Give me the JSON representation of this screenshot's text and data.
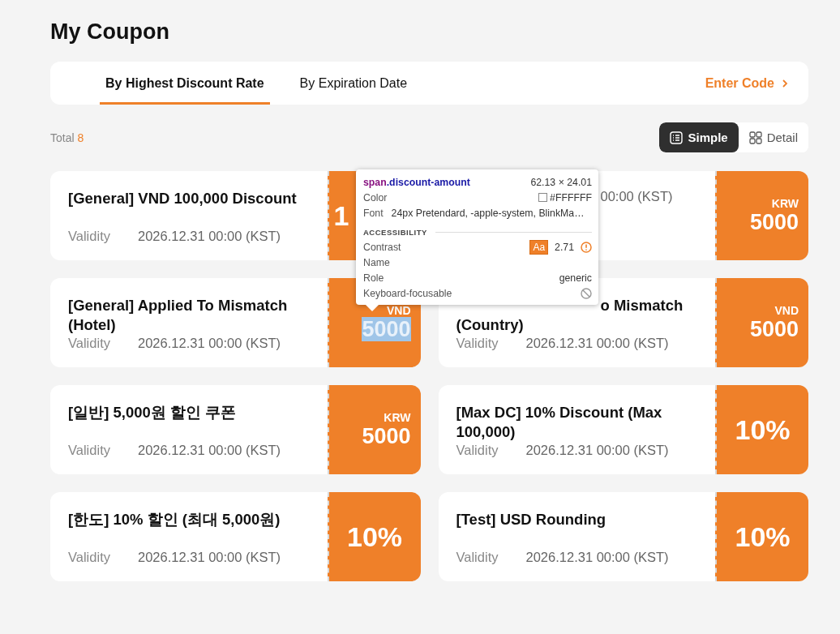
{
  "page_title": "My Coupon",
  "tabs": [
    {
      "label": "By Highest Discount Rate",
      "selected": true
    },
    {
      "label": "By Expiration Date",
      "selected": false
    }
  ],
  "enter_code": "Enter Code",
  "total": {
    "label": "Total",
    "count": "8"
  },
  "view_toggle": [
    {
      "label": "Simple",
      "selected": true,
      "kind": "list"
    },
    {
      "label": "Detail",
      "selected": false,
      "kind": "grid"
    }
  ],
  "coupons": [
    {
      "title": "[General] VND 100,000 Discount",
      "validity_label": "Validity",
      "validity": "2026.12.31 00:00 (KST)",
      "kind": "percent",
      "amount": "1",
      "text_covered": false,
      "stub_covered": true,
      "selected": false
    },
    {
      "validity": "00:00 (KST)",
      "kind": "fixed",
      "currency": "KRW",
      "amount": "5000",
      "text_covered": true,
      "stub_covered": false,
      "selected": false
    },
    {
      "title": "[General] Applied To Mismatch (Hotel)",
      "validity_label": "Validity",
      "validity": "2026.12.31 00:00 (KST)",
      "kind": "fixed",
      "currency": "VND",
      "amount": "5000",
      "text_covered": false,
      "stub_covered": false,
      "selected": true
    },
    {
      "title": "o Mismatch (Country)",
      "validity_label": "Validity",
      "validity": "2026.12.31 00:00 (KST)",
      "kind": "fixed",
      "currency": "VND",
      "amount": "5000",
      "text_covered": true,
      "stub_covered": false,
      "selected": false
    },
    {
      "title": "[일반] 5,000원 할인 쿠폰",
      "validity_label": "Validity",
      "validity": "2026.12.31 00:00 (KST)",
      "kind": "fixed",
      "currency": "KRW",
      "amount": "5000",
      "text_covered": false,
      "stub_covered": false,
      "selected": false
    },
    {
      "title": "[Max DC] 10% Discount (Max 100,000)",
      "validity_label": "Validity",
      "validity": "2026.12.31 00:00 (KST)",
      "kind": "percent",
      "amount": "10%",
      "text_covered": false,
      "stub_covered": false,
      "selected": false
    },
    {
      "title": "[한도] 10% 할인 (최대 5,000원)",
      "validity_label": "Validity",
      "validity": "2026.12.31 00:00 (KST)",
      "kind": "percent",
      "amount": "10%",
      "text_covered": false,
      "stub_covered": false,
      "selected": false
    },
    {
      "title": "[Test] USD Rounding",
      "validity_label": "Validity",
      "validity": "2026.12.31 00:00 (KST)",
      "kind": "percent",
      "amount": "10%",
      "text_covered": false,
      "stub_covered": false,
      "selected": false
    }
  ],
  "inspector": {
    "tag": "span",
    "class_name": ".discount-amount",
    "size": "62.13 × 24.01",
    "rows": [
      {
        "label": "Color",
        "value": "#FFFFFF",
        "kind": "color"
      },
      {
        "label": "Font",
        "value": "24px Pretendard, -apple-system, BlinkMa…",
        "kind": "text"
      }
    ],
    "section": "ACCESSIBILITY",
    "a11y": [
      {
        "label": "Contrast",
        "badge": "Aa",
        "value": "2.71",
        "kind": "contrast"
      },
      {
        "label": "Name",
        "kind": "empty"
      },
      {
        "label": "Role",
        "value": "generic",
        "kind": "text"
      },
      {
        "label": "Keyboard-focusable",
        "kind": "blocked"
      }
    ]
  }
}
